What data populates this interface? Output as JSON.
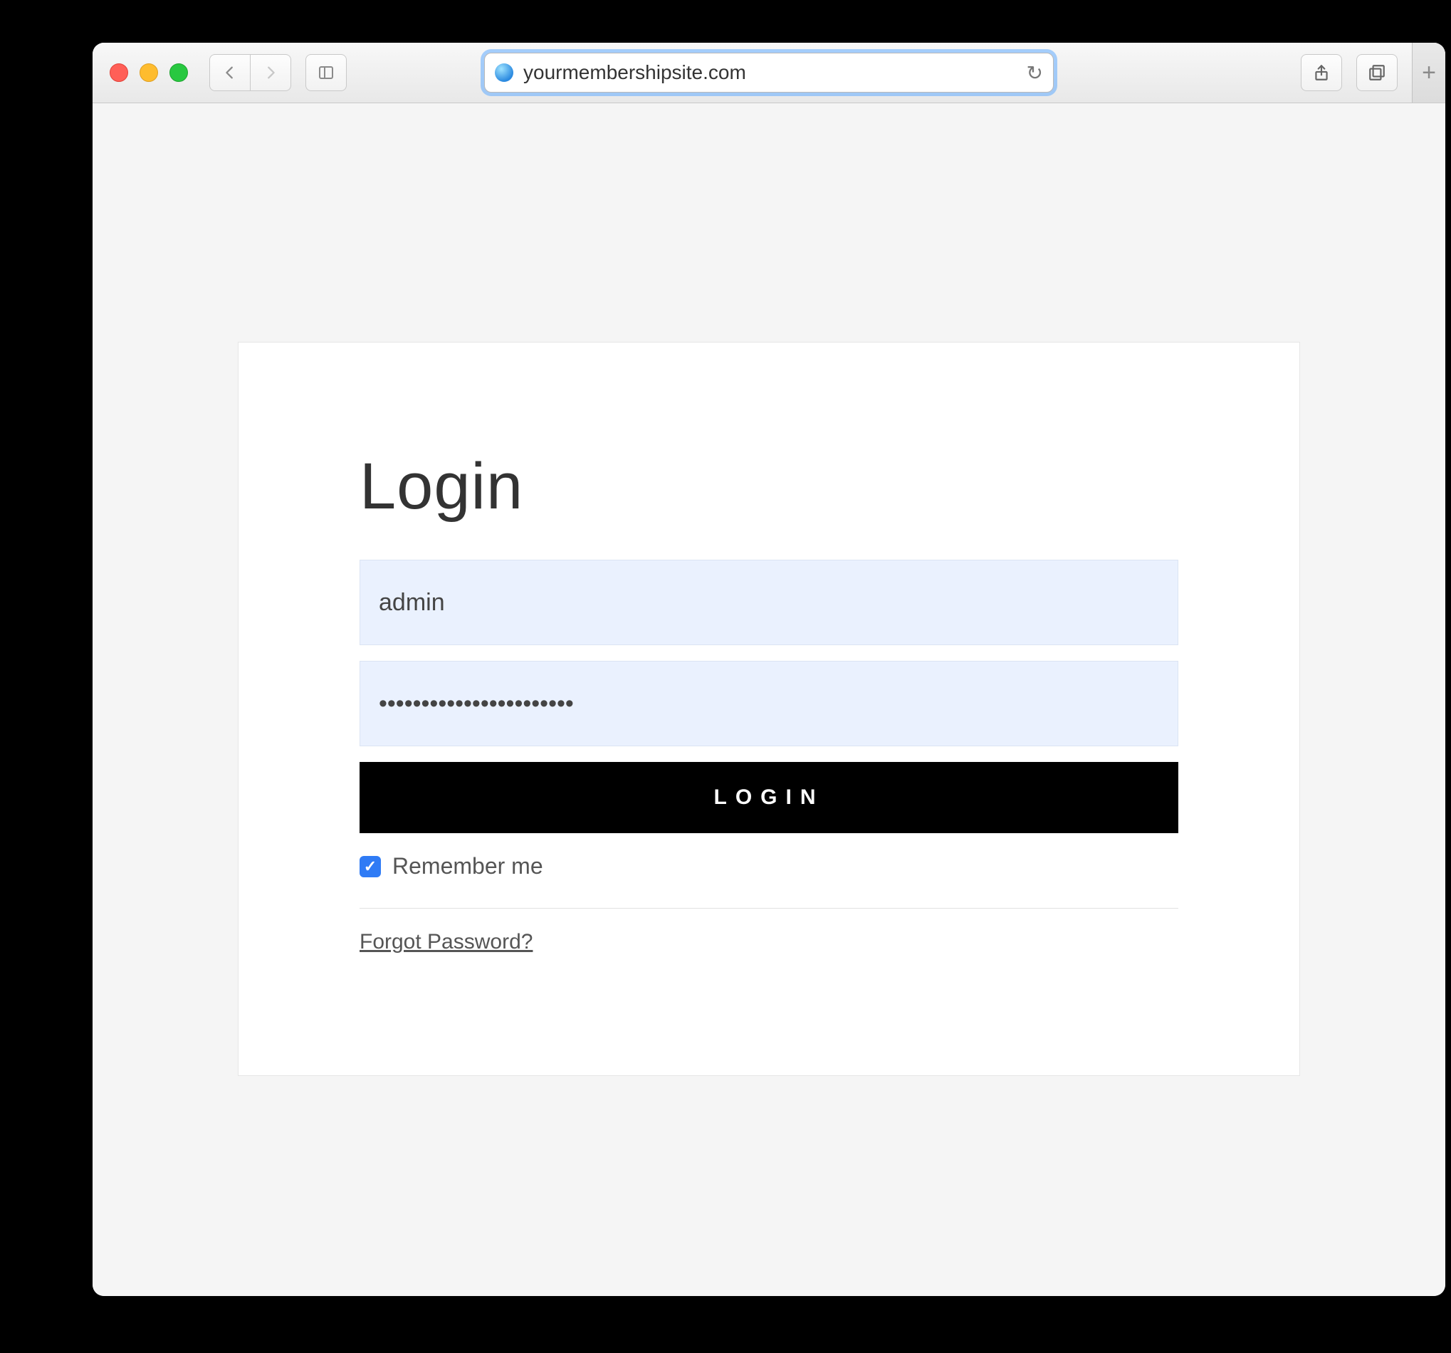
{
  "browser": {
    "address": "yourmembershipsite.com"
  },
  "login": {
    "title": "Login",
    "username_value": "admin",
    "password_value": "•••••••••••••••••••••••",
    "button_label": "LOGIN",
    "remember_label": "Remember me",
    "remember_checked": true,
    "forgot_label": "Forgot Password?"
  }
}
